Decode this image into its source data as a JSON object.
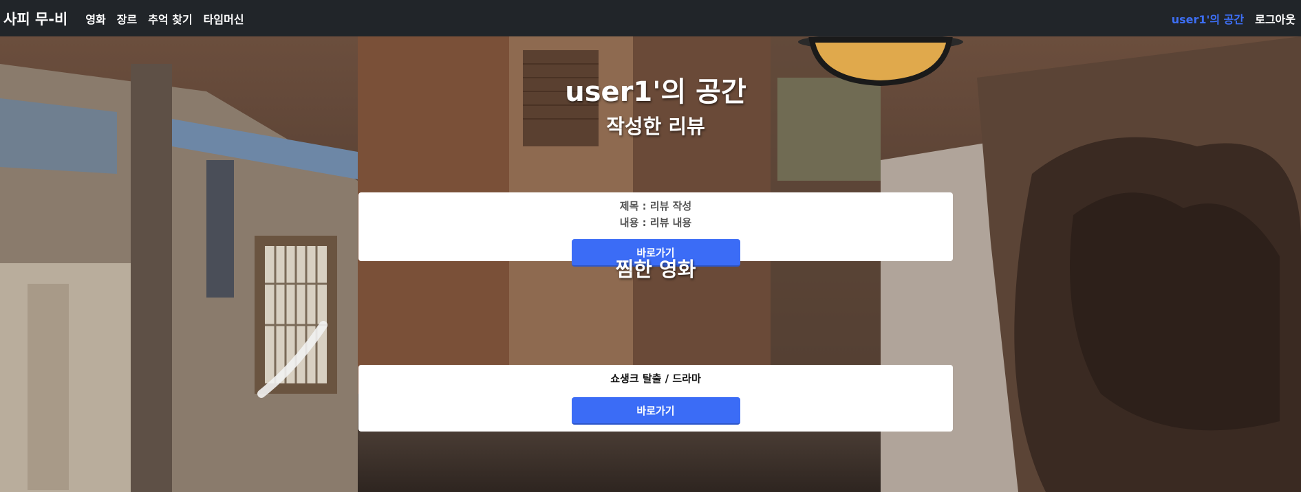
{
  "navbar": {
    "brand": "사피 무-비",
    "links": [
      "영화",
      "장르",
      "추억 찾기",
      "타임머신"
    ],
    "profile_link": "user1'의 공간",
    "logout_link": "로그아웃"
  },
  "page": {
    "title": "user1'의 공간"
  },
  "reviews_section": {
    "title": "작성한 리뷰",
    "items": [
      {
        "title_line": "제목 : 리뷰 작성",
        "content_line": "내용 : 리뷰 내용",
        "button_label": "바로가기"
      }
    ]
  },
  "liked_section": {
    "title": "찜한 영화",
    "items": [
      {
        "movie_line": "쇼생크 탈출 / 드라마",
        "button_label": "바로가기"
      }
    ]
  },
  "colors": {
    "navbar_bg": "#212529",
    "accent": "#3b6cf6",
    "active_link": "#3d6ff5"
  }
}
